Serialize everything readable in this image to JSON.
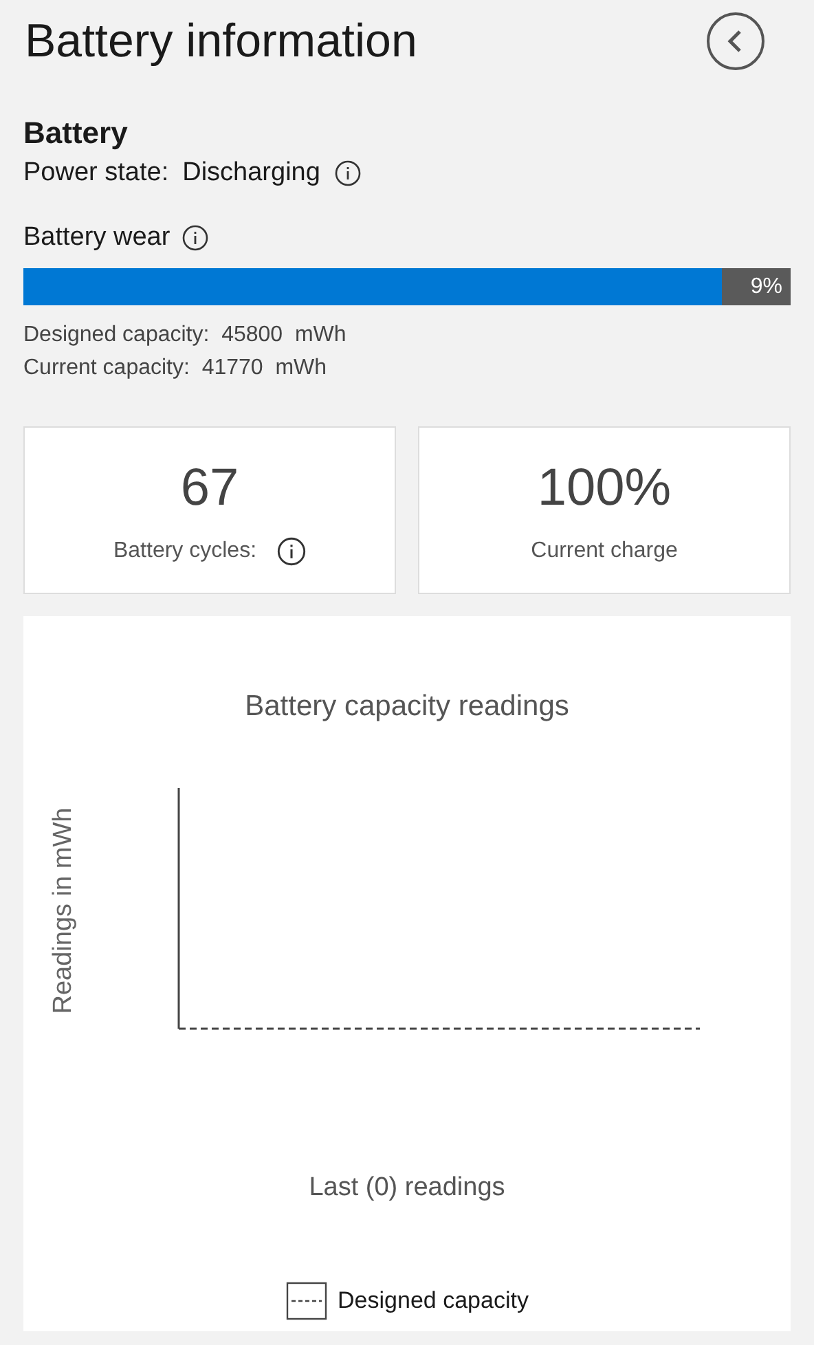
{
  "header": {
    "title": "Battery information"
  },
  "battery": {
    "heading": "Battery",
    "power_state_label": "Power state:",
    "power_state_value": "Discharging",
    "wear_label": "Battery wear",
    "wear": {
      "level": 0.91,
      "reading": "9%"
    },
    "designed_capacity": "Designed capacity:  45800  mWh",
    "current_capacity": "Current capacity:  41770  mWh"
  },
  "cards": [
    {
      "value": "67",
      "label": "Battery cycles:",
      "info": true
    },
    {
      "value": "100%",
      "label": "Current charge",
      "info": false
    }
  ],
  "chart": {
    "title": "Battery capacity readings",
    "ylabel": "Readings in mWh",
    "xlabel": "Last (0) readings",
    "legend": "Designed capacity"
  }
}
